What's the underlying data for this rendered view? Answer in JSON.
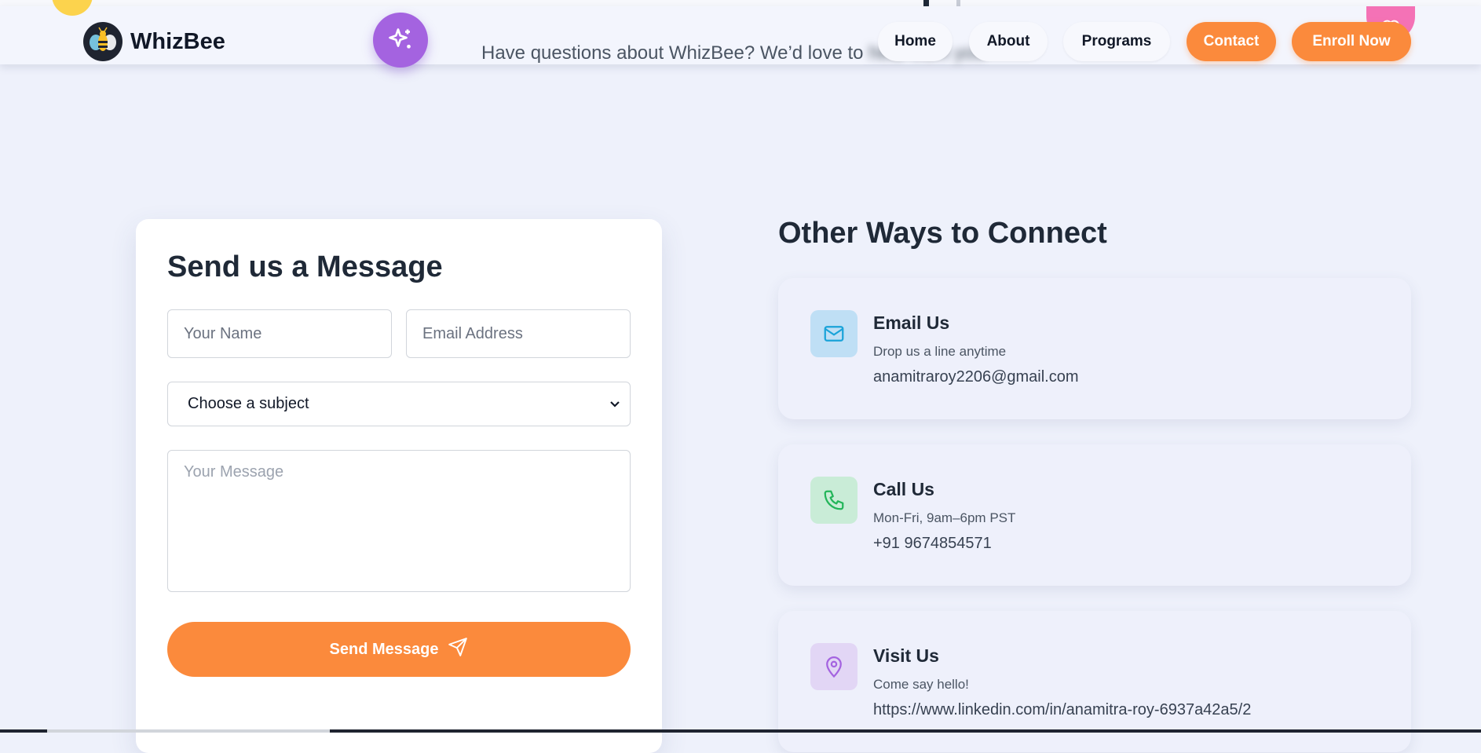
{
  "brand": {
    "name": "WhizBee",
    "logo_icon": "bee-icon"
  },
  "hero": {
    "subtitle_visible": "Have questions about WhizBee? We’d love to",
    "subtitle_blurred": "hear from you"
  },
  "nav": {
    "home": "Home",
    "about": "About",
    "programs": "Programs",
    "contact": "Contact",
    "enroll": "Enroll Now"
  },
  "form": {
    "title": "Send us a Message",
    "name_placeholder": "Your Name",
    "email_placeholder": "Email Address",
    "subject_selected": "Choose a subject",
    "message_placeholder": "Your Message",
    "submit_label": "Send Message"
  },
  "connect": {
    "title": "Other Ways to Connect",
    "cards": [
      {
        "title": "Email Us",
        "subtitle": "Drop us a line anytime",
        "value": "anamitraroy2206@gmail.com",
        "icon": "mail-icon",
        "icon_bg": "#bfdff5",
        "icon_color": "#1aa3d9"
      },
      {
        "title": "Call Us",
        "subtitle": "Mon-Fri, 9am–6pm PST",
        "value": "+91 9674854571",
        "icon": "phone-icon",
        "icon_bg": "#c9ecd7",
        "icon_color": "#22b559"
      },
      {
        "title": "Visit Us",
        "subtitle": "Come say hello!",
        "value": "https://www.linkedin.com/in/anamitra-roy-6937a42a5/2",
        "icon": "map-pin-icon",
        "icon_bg": "#e2d6f5",
        "icon_color": "#a463e0"
      }
    ]
  },
  "colors": {
    "accent": "#fb8a3c",
    "sparkle": "#a463e0",
    "background": "#eef1fb"
  }
}
